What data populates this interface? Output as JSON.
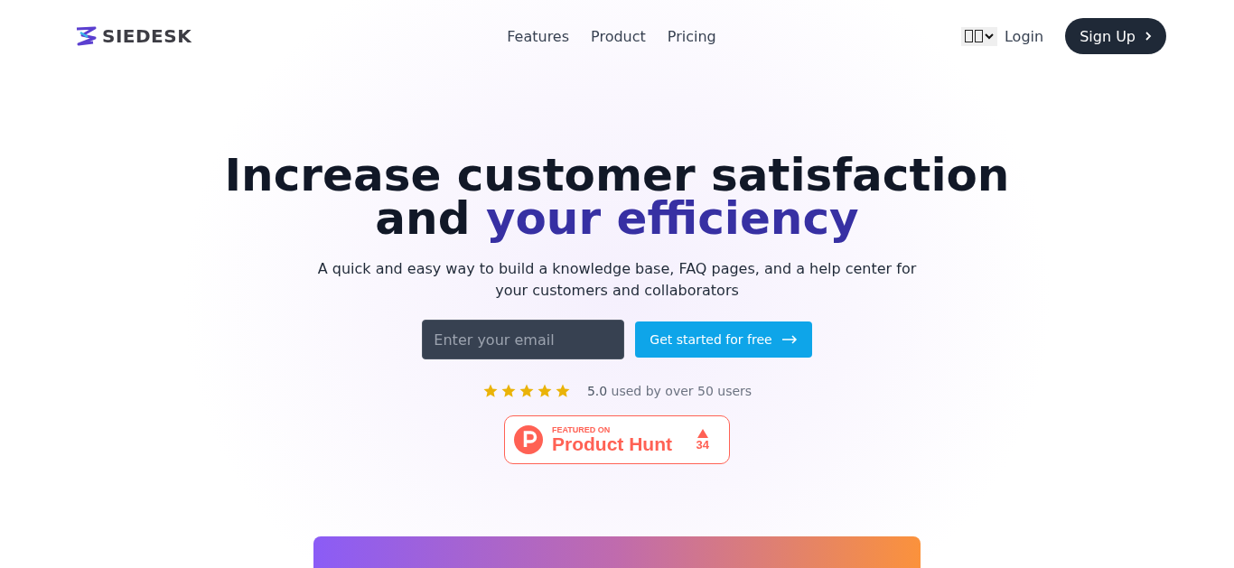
{
  "nav": {
    "logo": "SIEDESK",
    "links": [
      "Features",
      "Product",
      "Pricing"
    ],
    "login": "Login",
    "signup": "Sign Up"
  },
  "hero": {
    "title": "Increase customer satisfaction",
    "title_end_plain": "and",
    "title_end_accent": "your efficiency",
    "subtitle": "A quick and easy way to build a knowledge base, FAQ pages, and a help center for your customers and collaborators",
    "email": {
      "placeholder": "Enter your email"
    },
    "cta": "Get started for free",
    "rating": {
      "stars": 5,
      "score": "5.0",
      "text": "used by over 50 users"
    },
    "product_hunt": {
      "eyebrow": "FEATURED ON",
      "name": "Product Hunt",
      "votes": "34"
    }
  },
  "banner": {
    "kind": "gradient"
  }
}
